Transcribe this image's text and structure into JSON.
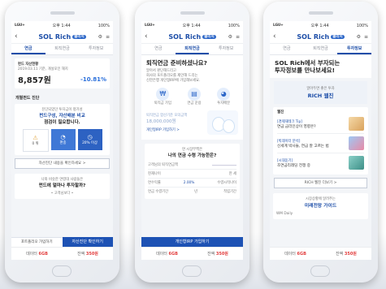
{
  "status": {
    "carrier": "LGU+",
    "time": "오후 1:44",
    "battery": "100%"
  },
  "app": {
    "logo": "SOL Rich",
    "logo_sub": "쏠리치"
  },
  "tabs": [
    "연금",
    "퇴직연금",
    "투자정보"
  ],
  "bottom": {
    "cash_label": "데이터",
    "cash_value": "6GB",
    "point_label": "잔액",
    "point_value": "350원"
  },
  "phone1": {
    "account_label": "펀드 자산현황",
    "account_sub": "2019.03.11 기준, 개설포인 해지",
    "amount": "8,857원",
    "rate": "-10.81%",
    "section": "개별펀드 진단",
    "diag_text_1": "진단되었던 투자금이 평가성",
    "diag_text_2": "펀드구성, 자산배분 비교",
    "diag_text_3": "점검이 필요합니다.",
    "options": [
      "0 위",
      "편중",
      "20% 이상"
    ],
    "compare_link": "자산진단 내용을 확인하세요 >",
    "question_1": "나와 비슷한 연령대 사람들은",
    "question_2": "펀드에 얼마나 투자할까?",
    "nav_dots": "• 고객님보다 •",
    "btn_left": "포트폴리오 가입하기",
    "btn_right": "자산진단 확인하기"
  },
  "phone2": {
    "headline": "퇴직연금 준비하셨나요?",
    "desc_1": "알아서 판단해드리고",
    "desc_2": "회사의 포트폴리오를 제안해 드리는",
    "desc_3": "신한은행 개인형IRP에 가입해보세요.",
    "steps": [
      "퇴직금 가입",
      "연금 운용",
      "투자배분"
    ],
    "target_label": "퇴직연금 합산기준 모의금액",
    "target_value": "18,000,000원",
    "link": "개인형IRP 가입하기 >",
    "calc_q1": "연 시장부쩍은",
    "calc_q2": "나의 연금 수령 가능한은?",
    "fields": [
      {
        "label": "고객님의 퇴직연금액",
        "value": ""
      },
      {
        "label": "현재나이",
        "value": "만 세"
      },
      {
        "label": "연수익률",
        "value": "2.00%",
        "extra": "수령시작나이"
      },
      {
        "label": "연금 수령기간",
        "value": "년",
        "extra": "적립기간"
      }
    ],
    "cta": "개인형IRP 가입하기"
  },
  "phone3": {
    "headline_1": "SOL Rich에서 부자되는",
    "headline_2": "투자정보를 만나보세요!",
    "box_kicker": "알아두면 좋은 투자",
    "box_title": "RICH 웹진",
    "section": "웹진",
    "articles": [
      {
        "tag": "[경제재테크 Tip]",
        "title": "연금 금리인상이 영향은?"
      },
      {
        "tag": "[빅데이터 분석]",
        "title": "신세계 박사들, 연금 잘 고르는 법"
      },
      {
        "tag": "[시대돋기]",
        "title": "조연금리래딩 전쟁 중"
      }
    ],
    "more": "RICH 웹진 더보기 >",
    "lower_kicker": "시장상황에 알려주는",
    "lower_title": "미래전망 가이드",
    "lower_item": "WM Daily"
  }
}
